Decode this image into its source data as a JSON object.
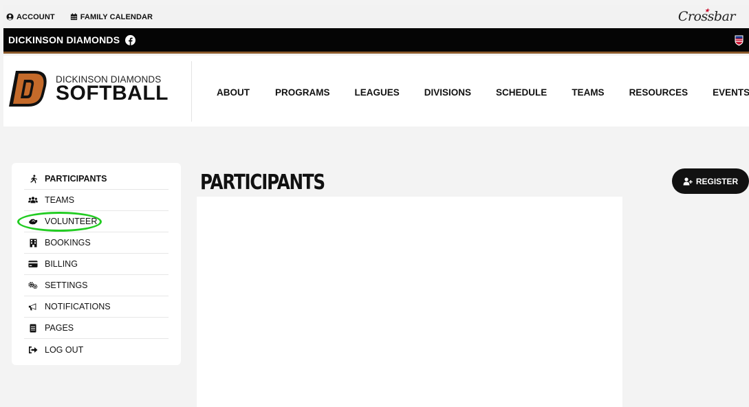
{
  "utility_bar": {
    "account_label": "ACCOUNT",
    "calendar_label": "FAMILY CALENDAR",
    "brand_label": "Crossbar"
  },
  "org_bar": {
    "org_name": "DICKINSON DIAMONDS"
  },
  "header": {
    "logo_subtitle": "DICKINSON DIAMONDS",
    "logo_title": "SOFTBALL",
    "nav": [
      "ABOUT",
      "PROGRAMS",
      "LEAGUES",
      "DIVISIONS",
      "SCHEDULE",
      "TEAMS",
      "RESOURCES",
      "EVENTS"
    ]
  },
  "sidebar": {
    "items": [
      {
        "label": "PARTICIPANTS",
        "icon": "running-icon",
        "active": true
      },
      {
        "label": "TEAMS",
        "icon": "users-icon",
        "active": false
      },
      {
        "label": "VOLUNTEER",
        "icon": "handshake-icon",
        "active": false,
        "highlighted": true
      },
      {
        "label": "BOOKINGS",
        "icon": "building-icon",
        "active": false
      },
      {
        "label": "BILLING",
        "icon": "credit-card-icon",
        "active": false
      },
      {
        "label": "SETTINGS",
        "icon": "gears-icon",
        "active": false
      },
      {
        "label": "NOTIFICATIONS",
        "icon": "megaphone-icon",
        "active": false
      },
      {
        "label": "PAGES",
        "icon": "file-icon",
        "active": false
      },
      {
        "label": "LOG OUT",
        "icon": "sign-out-icon",
        "active": false
      }
    ]
  },
  "main": {
    "title": "PARTICIPANTS",
    "register_label": "REGISTER"
  },
  "colors": {
    "accent_brown": "#8b5a2b",
    "logo_orange": "#c46a2a",
    "highlight_green": "#22cc22",
    "org_bar_bg": "#050505"
  }
}
